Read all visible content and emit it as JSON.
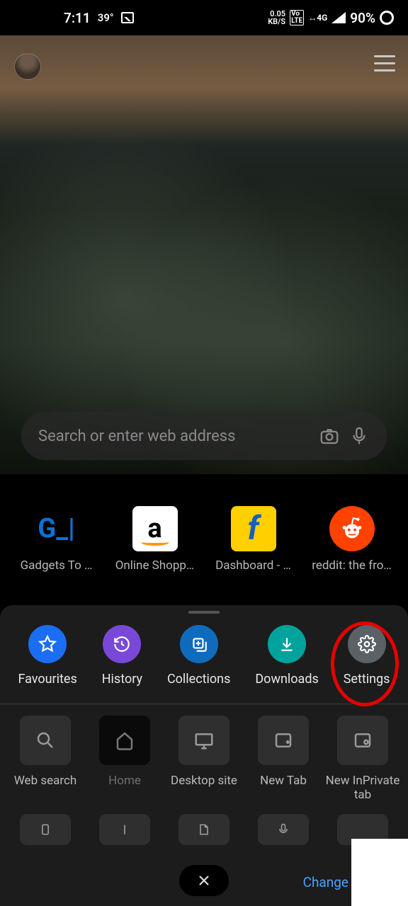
{
  "statusbar": {
    "time": "7:11",
    "temp": "39°",
    "kbps": "0.05",
    "kbps_unit": "KB/S",
    "lte": "Vo\nLTE",
    "net": "4G",
    "battery": "90%"
  },
  "search": {
    "placeholder": "Search or enter web address"
  },
  "shortcuts": [
    {
      "label": "Gadgets To …",
      "glyph": "G_|"
    },
    {
      "label": "Online Shopp…",
      "glyph": "a"
    },
    {
      "label": "Dashboard - …",
      "glyph": "f"
    },
    {
      "label": "reddit: the fro…",
      "glyph": ""
    }
  ],
  "menu_row1": [
    {
      "label": "Favourites",
      "color": "#1b6ef3"
    },
    {
      "label": "History",
      "color": "#7948d8"
    },
    {
      "label": "Collections",
      "color": "#0f6cbd"
    },
    {
      "label": "Downloads",
      "color": "#00a39b"
    },
    {
      "label": "Settings",
      "color": "#5a6268"
    }
  ],
  "menu_row2": [
    {
      "label": "Web search"
    },
    {
      "label": "Home"
    },
    {
      "label": "Desktop site"
    },
    {
      "label": "New Tab"
    },
    {
      "label": "New InPrivate tab"
    }
  ],
  "change_label": "Change"
}
